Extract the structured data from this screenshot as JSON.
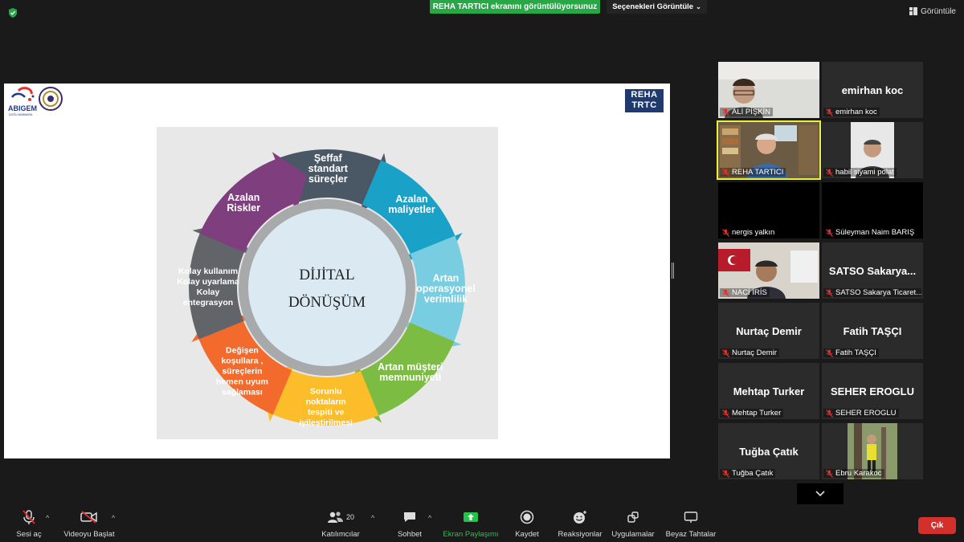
{
  "top": {
    "share_banner": "REHA TARTICI ekranını görüntülüyorsunuz",
    "view_options": "Seçenekleri Görüntüle",
    "view_button": "Görüntüle"
  },
  "slide": {
    "reha_logo_line1": "REHA",
    "reha_logo_line2": "TRTC",
    "abigem_logo_text": "ABIGEM",
    "abigem_logo_sub": "DOĞU MARMARA",
    "center_line1": "DİJİTAL",
    "center_line2": "DÖNÜŞÜM",
    "segments": [
      {
        "lines": [
          "Şeffaf",
          "standart",
          "süreçler"
        ],
        "color": "#4a5866"
      },
      {
        "lines": [
          "Azalan",
          "maliyetler"
        ],
        "color": "#1aa1c7"
      },
      {
        "lines": [
          "Artan",
          "operasyonel",
          "verimlilik"
        ],
        "color": "#79cde0"
      },
      {
        "lines": [
          "Artan müşteri",
          "memnuniyeti"
        ],
        "color": "#7dbc43"
      },
      {
        "lines": [
          "Sorunlu",
          "noktaların",
          "tespiti ve",
          "iyileştirilmesi"
        ],
        "color": "#fbbd2a"
      },
      {
        "lines": [
          "Değişen",
          "koşullara ,",
          "süreçlerin",
          "hemen uyum",
          "sağlaması"
        ],
        "color": "#f26a2c"
      },
      {
        "lines": [
          "Kolay kullanım",
          "Kolay uyarlama",
          "Kolay",
          "entegrasyon"
        ],
        "color": "#616569"
      },
      {
        "lines": [
          "Azalan",
          "Riskler"
        ],
        "color": "#7f3f7e"
      }
    ]
  },
  "participants": [
    {
      "name": "ALİ PİŞKİN",
      "big": "",
      "video": true,
      "muted": true
    },
    {
      "name": "emirhan koc",
      "big": "emirhan koc",
      "video": false,
      "muted": true
    },
    {
      "name": "REHA TARTICI",
      "big": "",
      "video": true,
      "muted": true,
      "active": true
    },
    {
      "name": "habil siyami polat",
      "big": "",
      "video": true,
      "muted": true
    },
    {
      "name": "nergis yalkın",
      "big": "",
      "video": false,
      "muted": true,
      "black": true
    },
    {
      "name": "Süleyman Naim BARIŞ",
      "big": "",
      "video": false,
      "muted": true,
      "black": true
    },
    {
      "name": "NACİ İRİS",
      "big": "",
      "video": true,
      "muted": true
    },
    {
      "name": "SATSO Sakarya Ticaret...",
      "big": "SATSO Sakarya...",
      "video": false,
      "muted": true
    },
    {
      "name": "Nurtaç Demir",
      "big": "Nurtaç Demir",
      "video": false,
      "muted": true
    },
    {
      "name": "Fatih TAŞÇI",
      "big": "Fatih TAŞÇI",
      "video": false,
      "muted": true
    },
    {
      "name": "Mehtap Turker",
      "big": "Mehtap Turker",
      "video": false,
      "muted": true
    },
    {
      "name": "SEHER EROGLU",
      "big": "SEHER EROGLU",
      "video": false,
      "muted": true
    },
    {
      "name": "Tuğba Çatık",
      "big": "Tuğba Çatık",
      "video": false,
      "muted": true
    },
    {
      "name": "Ebru Karakoc",
      "big": "",
      "video": true,
      "muted": true
    }
  ],
  "toolbar": {
    "unmute": "Sesi aç",
    "start_video": "Videoyu Başlat",
    "participants": "Katılımcılar",
    "participants_count": "20",
    "chat": "Sohbet",
    "share_screen": "Ekran Paylaşımı",
    "record": "Kaydet",
    "reactions": "Reaksiyonlar",
    "apps": "Uygulamalar",
    "whiteboards": "Beyaz Tahtalar",
    "leave": "Çık"
  },
  "colors": {
    "share_green": "#27a745",
    "leave_red": "#d3302c",
    "active_speaker": "#e9f13c"
  }
}
